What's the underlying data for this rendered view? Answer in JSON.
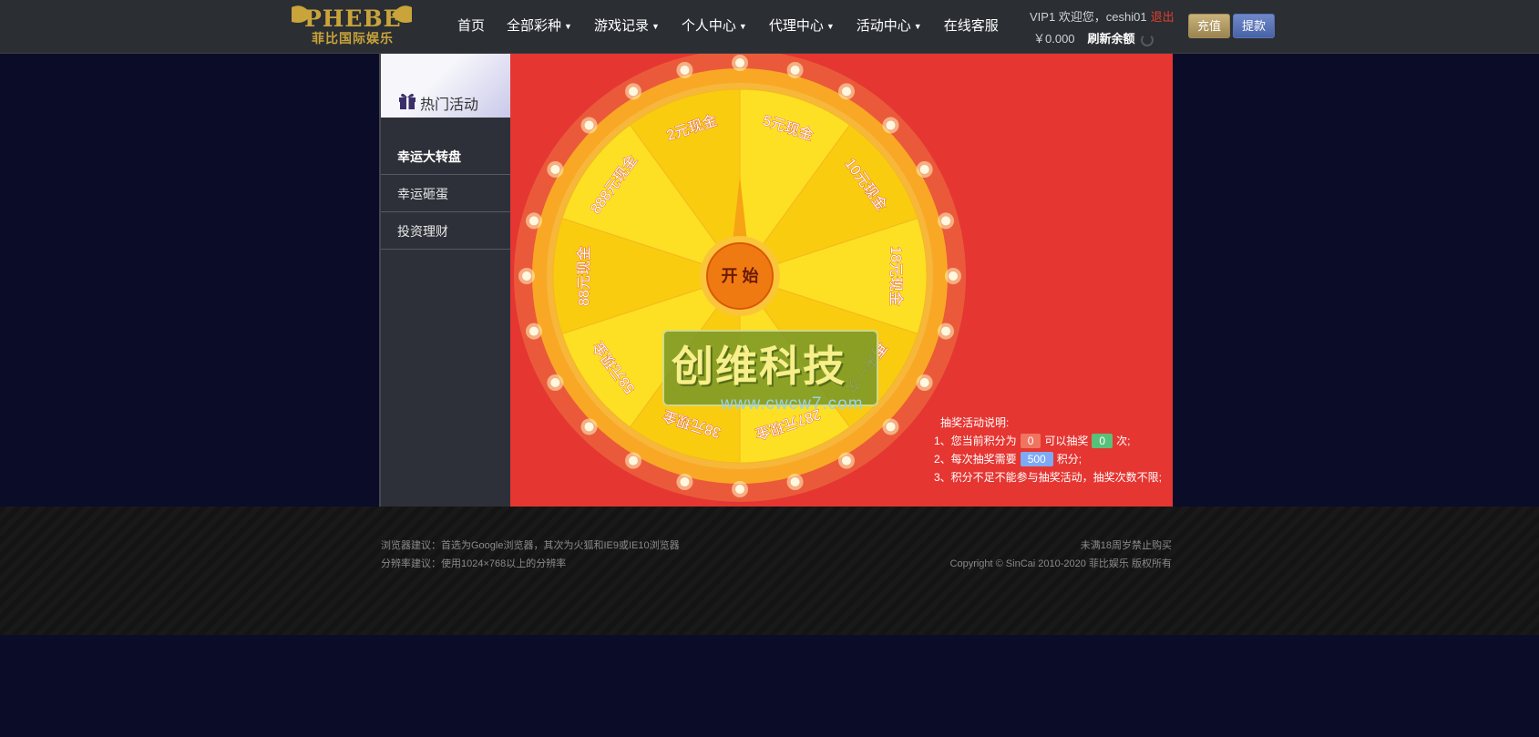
{
  "logo": {
    "brand": "PHEBE",
    "subtitle": "菲比国际娱乐"
  },
  "nav": [
    {
      "label": "首页",
      "has_caret": false
    },
    {
      "label": "全部彩种",
      "has_caret": true
    },
    {
      "label": "游戏记录",
      "has_caret": true
    },
    {
      "label": "个人中心",
      "has_caret": true
    },
    {
      "label": "代理中心",
      "has_caret": true
    },
    {
      "label": "活动中心",
      "has_caret": true
    },
    {
      "label": "在线客服",
      "has_caret": false
    }
  ],
  "user": {
    "greeting": "VIP1 欢迎您，ceshi01",
    "logout": "退出",
    "balance": "￥0.000",
    "refresh": "刷新余额"
  },
  "buttons": {
    "recharge": "充值",
    "withdraw": "提款"
  },
  "sidebar": {
    "title": "热门活动",
    "items": [
      {
        "label": "幸运大转盘",
        "active": true
      },
      {
        "label": "幸运砸蛋",
        "active": false
      },
      {
        "label": "投资理财",
        "active": false
      }
    ]
  },
  "wheel": {
    "start_label": "开 始",
    "prizes": [
      "5元现金",
      "10元现金",
      "18元现金",
      "再来一次",
      "287元现金",
      "38元现金",
      "58元现金",
      "88元现金",
      "888元现金",
      "2元现金"
    ],
    "colors": {
      "light": "#fde023",
      "dark": "#f9cc10",
      "rim": "#f9a826",
      "text": "#e0553a"
    }
  },
  "watermark": {
    "title": "创维科技",
    "url": "www.cwcw7.com"
  },
  "rules": {
    "heading": "抽奖活动说明:",
    "line1_prefix": "1、您当前积分为",
    "points": "0",
    "line1_mid": "可以抽奖",
    "draws": "0",
    "line1_suffix": "次;",
    "line2_prefix": "2、每次抽奖需要",
    "cost": "500",
    "line2_suffix": "积分;",
    "line3": "3、积分不足不能参与抽奖活动，抽奖次数不限;"
  },
  "footer": {
    "left1": "浏览器建议：首选为Google浏览器，其次为火狐和IE9或IE10浏览器",
    "left2": "分辨率建议：使用1024×768以上的分辨率",
    "right1": "未满18周岁禁止购买",
    "right2": "Copyright © SinCai 2010-2020 菲比娱乐 版权所有"
  }
}
